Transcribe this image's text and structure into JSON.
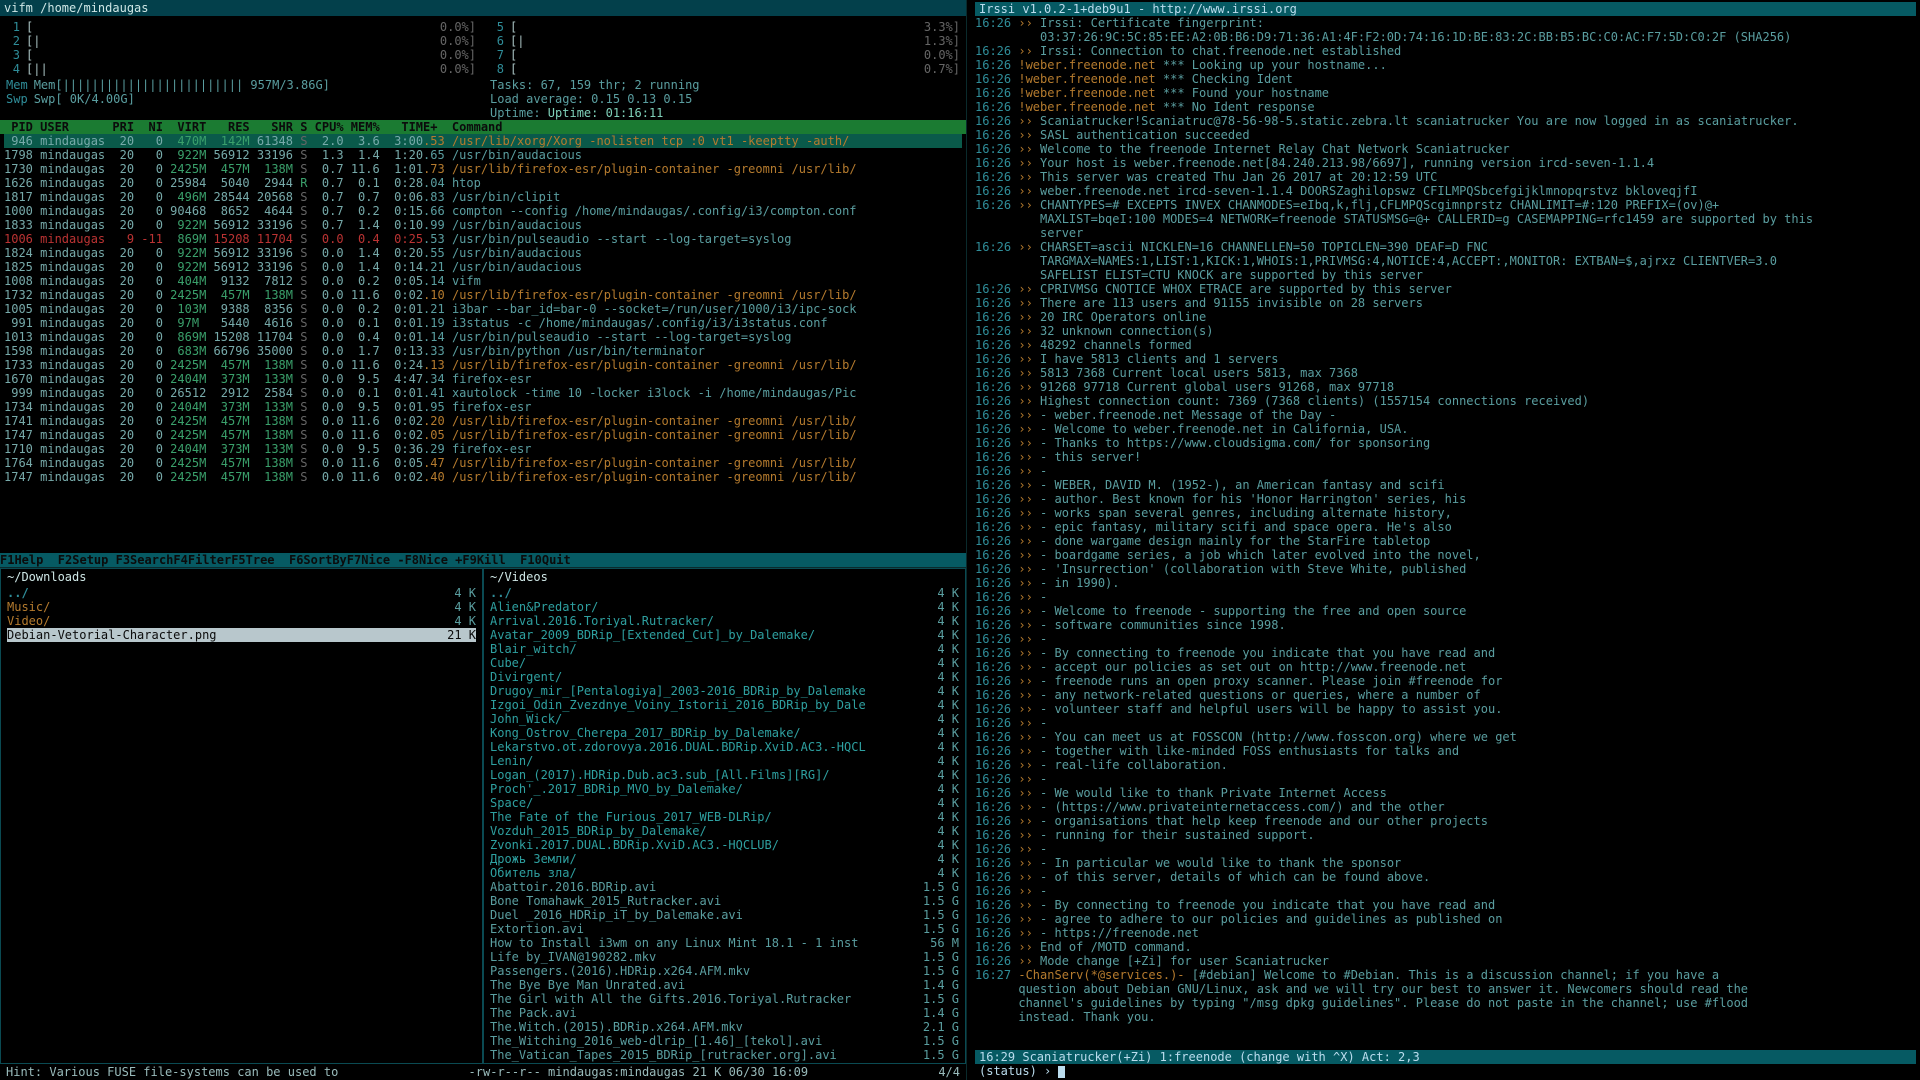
{
  "title": "vifm  /home/mindaugas",
  "htop": {
    "cpus_left": [
      {
        "n": "1",
        "bar": "[",
        "pct": "0.0%"
      },
      {
        "n": "2",
        "bar": "[|",
        "pct": "0.0%"
      },
      {
        "n": "3",
        "bar": "[",
        "pct": "0.0%"
      },
      {
        "n": "4",
        "bar": "[||",
        "pct": "0.0%"
      }
    ],
    "cpus_right": [
      {
        "n": "5",
        "bar": "[",
        "pct": "3.3%"
      },
      {
        "n": "6",
        "bar": "[|",
        "pct": "1.3%"
      },
      {
        "n": "7",
        "bar": "[",
        "pct": "0.0%"
      },
      {
        "n": "8",
        "bar": "[",
        "pct": "0.7%"
      }
    ],
    "mem": "Mem[|||||||||||||||||||||||||                    957M/3.86G]",
    "swp": "Swp[                                               0K/4.00G]",
    "tasks": "Tasks: 67, 159 thr; 2 running",
    "load": "Load average: 0.15 0.13 0.15",
    "uptime": "Uptime: 01:16:11",
    "header": " PID USER      PRI  NI  VIRT   RES   SHR S CPU% MEM%   TIME+  Command",
    "rows": [
      {
        "hl": true,
        "t": " 946 mindaugas  20   0  470M  142M 61348 S  2.0  3.6  3:00.53 /usr/lib/xorg/Xorg -nolisten tcp :0 vt1 -keeptty -auth/",
        "c": "cmdg"
      },
      {
        "t": "1798 mindaugas  20   0  922M 56912 33196 S  1.3  1.4  1:20.65 /usr/bin/audacious",
        "c": "cmd"
      },
      {
        "t": "1730 mindaugas  20   0 2425M  457M  138M S  0.7 11.6  1:01.73 /usr/lib/firefox-esr/plugin-container -greomni /usr/lib/",
        "c": "cmdg"
      },
      {
        "t": "1626 mindaugas  20   0 25984  5040  2944 R  0.7  0.1  0:28.04 htop",
        "c": "cmd"
      },
      {
        "t": "1817 mindaugas  20   0  496M 28544 20568 S  0.7  0.7  0:06.83 /usr/bin/clipit",
        "c": "cmd"
      },
      {
        "t": "1000 mindaugas  20   0 90468  8652  4644 S  0.7  0.2  0:15.66 compton --config /home/mindaugas/.config/i3/compton.conf",
        "c": "cmd"
      },
      {
        "t": "1833 mindaugas  20   0  922M 56912 33196 S  0.7  1.4  0:10.99 /usr/bin/audacious",
        "c": "cmd"
      },
      {
        "t": "1006 mindaugas   9 -11  869M 15208 11704 S  0.0  0.4  0:25.53 /usr/bin/pulseaudio --start --log-target=syslog",
        "c": "cmd",
        "red": true
      },
      {
        "t": "1824 mindaugas  20   0  922M 56912 33196 S  0.0  1.4  0:20.55 /usr/bin/audacious",
        "c": "cmd"
      },
      {
        "t": "1825 mindaugas  20   0  922M 56912 33196 S  0.0  1.4  0:14.21 /usr/bin/audacious",
        "c": "cmd"
      },
      {
        "t": "1008 mindaugas  20   0  404M  9132  7812 S  0.0  0.2  0:05.14 vifm",
        "c": "cmd"
      },
      {
        "t": "1732 mindaugas  20   0 2425M  457M  138M S  0.0 11.6  0:02.10 /usr/lib/firefox-esr/plugin-container -greomni /usr/lib/",
        "c": "cmdg"
      },
      {
        "t": "1005 mindaugas  20   0  103M  9388  8356 S  0.0  0.2  0:01.21 i3bar --bar_id=bar-0 --socket=/run/user/1000/i3/ipc-sock",
        "c": "cmd"
      },
      {
        "t": " 991 mindaugas  20   0  97M   5440  4616 S  0.0  0.1  0:01.19 i3status -c /home/mindaugas/.config/i3/i3status.conf",
        "c": "cmd"
      },
      {
        "t": "1013 mindaugas  20   0  869M 15208 11704 S  0.0  0.4  0:01.14 /usr/bin/pulseaudio --start --log-target=syslog",
        "c": "cmd"
      },
      {
        "t": "1598 mindaugas  20   0  683M 66796 35000 S  0.0  1.7  0:13.33 /usr/bin/python /usr/bin/terminator",
        "c": "cmd"
      },
      {
        "t": "1733 mindaugas  20   0 2425M  457M  138M S  0.0 11.6  0:24.13 /usr/lib/firefox-esr/plugin-container -greomni /usr/lib/",
        "c": "cmdg"
      },
      {
        "t": "1670 mindaugas  20   0 2404M  373M  133M S  0.0  9.5  4:47.34 firefox-esr",
        "c": "cmd"
      },
      {
        "t": " 999 mindaugas  20   0 26512  2912  2584 S  0.0  0.1  0:01.41 xautolock -time 10 -locker i3lock -i /home/mindaugas/Pic",
        "c": "cmd"
      },
      {
        "t": "1734 mindaugas  20   0 2404M  373M  133M S  0.0  9.5  0:01.95 firefox-esr",
        "c": "cmd"
      },
      {
        "t": "1741 mindaugas  20   0 2425M  457M  138M S  0.0 11.6  0:02.20 /usr/lib/firefox-esr/plugin-container -greomni /usr/lib/",
        "c": "cmdg"
      },
      {
        "t": "1747 mindaugas  20   0 2425M  457M  138M S  0.0 11.6  0:02.05 /usr/lib/firefox-esr/plugin-container -greomni /usr/lib/",
        "c": "cmdg"
      },
      {
        "t": "1710 mindaugas  20   0 2404M  373M  133M S  0.0  9.5  0:36.29 firefox-esr",
        "c": "cmd"
      },
      {
        "t": "1764 mindaugas  20   0 2425M  457M  138M S  0.0 11.6  0:05.47 /usr/lib/firefox-esr/plugin-container -greomni /usr/lib/",
        "c": "cmdg"
      },
      {
        "t": "1747 mindaugas  20   0 2425M  457M  138M S  0.0 11.6  0:02.40 /usr/lib/firefox-esr/plugin-container -greomni /usr/lib/",
        "c": "cmdg"
      }
    ],
    "fkeys": "F1Help  F2Setup F3SearchF4FilterF5Tree  F6SortByF7Nice -F8Nice +F9Kill  F10Quit"
  },
  "vifm": {
    "left": {
      "title": "~/Downloads",
      "rows": [
        {
          "n": "../",
          "s": "4 K",
          "cls": "dir"
        },
        {
          "n": "Music/",
          "s": "4 K",
          "cls": "or"
        },
        {
          "n": "Video/",
          "s": "4 K",
          "cls": "or"
        },
        {
          "n": "Debian-Vetorial-Character.png",
          "s": "21 K",
          "sel": true
        }
      ]
    },
    "right": {
      "title": "~/Videos",
      "rows": [
        {
          "n": "../",
          "s": "4 K",
          "cls": "dir"
        },
        {
          "n": "Alien&Predator/",
          "s": "4 K",
          "cls": "cy"
        },
        {
          "n": "Arrival.2016.Toriyal.Rutracker/",
          "s": "4 K",
          "cls": "cy"
        },
        {
          "n": "Avatar_2009_BDRip_[Extended_Cut]_by_Dalemake/",
          "s": "4 K",
          "cls": "cy"
        },
        {
          "n": "Blair_witch/",
          "s": "4 K",
          "cls": "cy"
        },
        {
          "n": "Cube/",
          "s": "4 K",
          "cls": "cy"
        },
        {
          "n": "Divirgent/",
          "s": "4 K",
          "cls": "cy"
        },
        {
          "n": "Drugoy_mir_[Pentalogiya]_2003-2016_BDRip_by_Dalemake",
          "s": "4 K",
          "cls": "cy"
        },
        {
          "n": "Izgoi_Odin_Zvezdnye_Voiny_Istorii_2016_BDRip_by_Dale",
          "s": "4 K",
          "cls": "cy"
        },
        {
          "n": "John_Wick/",
          "s": "4 K",
          "cls": "cy"
        },
        {
          "n": "Kong_Ostrov_Cherepa_2017_BDRip_by_Dalemake/",
          "s": "4 K",
          "cls": "cy"
        },
        {
          "n": "Lekarstvo.ot.zdorovya.2016.DUAL.BDRip.XviD.AC3.-HQCL",
          "s": "4 K",
          "cls": "cy"
        },
        {
          "n": "Lenin/",
          "s": "4 K",
          "cls": "cy"
        },
        {
          "n": "Logan_(2017).HDRip.Dub.ac3.sub_[All.Films][RG]/",
          "s": "4 K",
          "cls": "cy"
        },
        {
          "n": "Proch'_.2017_BDRip_MVO_by_Dalemake/",
          "s": "4 K",
          "cls": "cy"
        },
        {
          "n": "Space/",
          "s": "4 K",
          "cls": "cy"
        },
        {
          "n": "The Fate of the Furious_2017_WEB-DLRip/",
          "s": "4 K",
          "cls": "cy"
        },
        {
          "n": "Vozduh_2015_BDRip_by_Dalemake/",
          "s": "4 K",
          "cls": "cy"
        },
        {
          "n": "Zvonki.2017.DUAL.BDRip.XviD.AC3.-HQCLUB/",
          "s": "4 K",
          "cls": "cy"
        },
        {
          "n": "Дрожь Земли/",
          "s": "4 K",
          "cls": "cy"
        },
        {
          "n": "Обитель зла/",
          "s": "4 K",
          "cls": "cy"
        },
        {
          "n": "Abattoir.2016.BDRip.avi",
          "s": "1.5 G"
        },
        {
          "n": "Bone Tomahawk_2015_Rutracker.avi",
          "s": "1.5 G"
        },
        {
          "n": "Duel _2016_HDRip_iT_by_Dalemake.avi",
          "s": "1.5 G"
        },
        {
          "n": "Extortion.avi",
          "s": "1.5 G"
        },
        {
          "n": "How to Install i3wm on any Linux Mint 18.1 - 1 inst",
          "s": "56 M"
        },
        {
          "n": "Life by_IVAN@190282.mkv",
          "s": "1.5 G"
        },
        {
          "n": "Passengers.(2016).HDRip.x264.AFM.mkv",
          "s": "1.5 G"
        },
        {
          "n": "The Bye Bye Man Unrated.avi",
          "s": "1.4 G"
        },
        {
          "n": "The Girl with All the Gifts.2016.Toriyal.Rutracker",
          "s": "1.5 G"
        },
        {
          "n": "The Pack.avi",
          "s": "1.4 G"
        },
        {
          "n": "The.Witch.(2015).BDRip.x264.AFM.mkv",
          "s": "2.1 G"
        },
        {
          "n": "The_Witching_2016_web-dlrip_[1.46]_[tekol].avi",
          "s": "1.5 G"
        },
        {
          "n": "The_Vatican_Tapes_2015_BDRip_[rutracker.org].avi",
          "s": "1.5 G"
        }
      ]
    },
    "status_left": "Hint: Various FUSE file-systems can be used to",
    "status_mid": "-rw-r--r--   mindaugas:mindaugas          21 K     06/30 16:09",
    "status_right": "4/4"
  },
  "irssi": {
    "header": " Irssi v1.0.2-1+deb9u1 - http://www.irssi.org",
    "lines": [
      "16:26 ›› Irssi: Certificate fingerprint:",
      "         03:37:26:9C:5C:85:EE:A2:0B:B6:D9:71:36:A1:4F:F2:0D:74:16:1D:BE:83:2C:BB:B5:BC:C0:AC:F7:5D:C0:2F (SHA256)",
      "16:26 ›› Irssi: Connection to chat.freenode.net established",
      "16:26 !weber.freenode.net *** Looking up your hostname...",
      "16:26 !weber.freenode.net *** Checking Ident",
      "16:26 !weber.freenode.net *** Found your hostname",
      "16:26 !weber.freenode.net *** No Ident response",
      "16:26 ›› Scaniatrucker!Scaniatruc@78-56-98-5.static.zebra.lt scaniatrucker You are now logged in as scaniatrucker.",
      "16:26 ›› SASL authentication succeeded",
      "16:26 ›› Welcome to the freenode Internet Relay Chat Network Scaniatrucker",
      "16:26 ›› Your host is weber.freenode.net[84.240.213.98/6697], running version ircd-seven-1.1.4",
      "16:26 ›› This server was created Thu Jan 26 2017 at 20:12:59 UTC",
      "16:26 ›› weber.freenode.net ircd-seven-1.1.4 DOORSZaghilopswz CFILMPQSbcefgijklmnopqrstvz bkloveqjfI",
      "16:26 ›› CHANTYPES=# EXCEPTS INVEX CHANMODES=eIbq,k,flj,CFLMPQScgimnprstz CHANLIMIT=#:120 PREFIX=(ov)@+",
      "         MAXLIST=bqeI:100 MODES=4 NETWORK=freenode STATUSMSG=@+ CALLERID=g CASEMAPPING=rfc1459 are supported by this",
      "         server",
      "16:26 ›› CHARSET=ascii NICKLEN=16 CHANNELLEN=50 TOPICLEN=390 DEAF=D FNC",
      "         TARGMAX=NAMES:1,LIST:1,KICK:1,WHOIS:1,PRIVMSG:4,NOTICE:4,ACCEPT:,MONITOR: EXTBAN=$,ajrxz CLIENTVER=3.0",
      "         SAFELIST ELIST=CTU KNOCK are supported by this server",
      "16:26 ›› CPRIVMSG CNOTICE WHOX ETRACE are supported by this server",
      "16:26 ›› There are 113 users and 91155 invisible on 28 servers",
      "16:26 ›› 20 IRC Operators online",
      "16:26 ›› 32 unknown connection(s)",
      "16:26 ›› 48292 channels formed",
      "16:26 ›› I have 5813 clients and 1 servers",
      "16:26 ›› 5813 7368 Current local users 5813, max 7368",
      "16:26 ›› 91268 97718 Current global users 91268, max 97718",
      "16:26 ›› Highest connection count: 7369 (7368 clients) (1557154 connections received)",
      "16:26 ›› - weber.freenode.net Message of the Day -",
      "16:26 ›› - Welcome to weber.freenode.net in California, USA.",
      "16:26 ›› - Thanks to https://www.cloudsigma.com/ for sponsoring",
      "16:26 ›› - this server!",
      "16:26 ›› -  ",
      "16:26 ›› - WEBER, DAVID M. (1952-), an American fantasy and scifi",
      "16:26 ›› - author. Best known for his 'Honor Harrington' series, his",
      "16:26 ›› - works span several genres, including alternate history,",
      "16:26 ›› - epic fantasy, military scifi and space opera. He's also",
      "16:26 ›› - done wargame design mainly for the StarFire tabletop",
      "16:26 ›› - boardgame series, a job which later evolved into the novel,",
      "16:26 ›› - 'Insurrection' (collaboration with Steve White, published",
      "16:26 ›› - in 1990).",
      "16:26 ›› -  ",
      "16:26 ›› - Welcome to freenode - supporting the free and open source",
      "16:26 ›› - software communities since 1998.",
      "16:26 ›› -  ",
      "16:26 ›› - By connecting to freenode you indicate that you have read and",
      "16:26 ›› - accept our policies as set out on http://www.freenode.net",
      "16:26 ›› - freenode runs an open proxy scanner. Please join #freenode for",
      "16:26 ›› - any network-related questions or queries, where a number of",
      "16:26 ›› - volunteer staff and helpful users will be happy to assist you.",
      "16:26 ›› -  ",
      "16:26 ›› - You can meet us at FOSSCON (http://www.fosscon.org) where we get",
      "16:26 ›› - together with like-minded FOSS enthusiasts for talks and",
      "16:26 ›› - real-life collaboration.",
      "16:26 ›› -  ",
      "16:26 ›› - We would like to thank Private Internet Access",
      "16:26 ›› - (https://www.privateinternetaccess.com/) and the other",
      "16:26 ›› - organisations that help keep freenode and our other projects",
      "16:26 ›› - running for their sustained support.",
      "16:26 ›› -  ",
      "16:26 ›› - In particular we would like to thank the sponsor",
      "16:26 ›› - of this server, details of which can be found above.",
      "16:26 ›› -  ",
      "16:26 ›› - By connecting to freenode you indicate that you have read and",
      "16:26 ›› - agree to adhere to our policies and guidelines as published on",
      "16:26 ›› - https://freenode.net",
      "16:26 ›› End of /MOTD command.",
      "16:26 ›› Mode change [+Zi] for user Scaniatrucker",
      "16:27 -ChanServ(*@services.)- [#debian] Welcome to #Debian. This is a discussion channel; if you have a",
      "      question about Debian GNU/Linux, ask and we will try our best to answer it. Newcomers should read the",
      "      channel's guidelines by typing \"/msg dpkg guidelines\". Please do not paste in the channel; use #flood",
      "      instead. Thank you."
    ],
    "statusbar": "16:29  Scaniatrucker(+Zi)  1:freenode (change with ^X)  Act: 2,3",
    "input": "(status) ›"
  }
}
